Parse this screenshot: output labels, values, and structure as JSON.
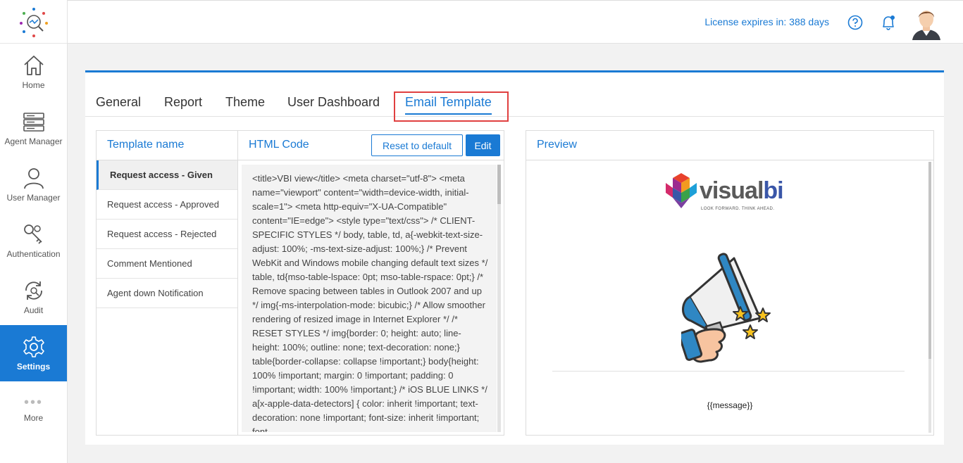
{
  "sidebar": {
    "items": [
      {
        "label": "Home",
        "icon": "home-icon"
      },
      {
        "label": "Agent Manager",
        "icon": "agent-manager-icon"
      },
      {
        "label": "User Manager",
        "icon": "user-icon"
      },
      {
        "label": "Authentication",
        "icon": "keys-icon"
      },
      {
        "label": "Audit",
        "icon": "audit-icon"
      },
      {
        "label": "Settings",
        "icon": "gear-icon",
        "active": true
      },
      {
        "label": "More",
        "icon": "more-icon"
      }
    ]
  },
  "header": {
    "license_text": "License expires in: 388 days"
  },
  "tabs": [
    {
      "label": "General"
    },
    {
      "label": "Report"
    },
    {
      "label": "Theme"
    },
    {
      "label": "User Dashboard"
    },
    {
      "label": "Email Template",
      "active": true
    }
  ],
  "templates": {
    "title": "Template name",
    "items": [
      "Request access - Given",
      "Request access - Approved",
      "Request access - Rejected",
      "Comment Mentioned",
      "Agent down Notification"
    ],
    "selected": "Request access - Given"
  },
  "code": {
    "title": "HTML Code",
    "reset_label": "Reset to default",
    "edit_label": "Edit",
    "content": "<title>VBI view</title> <meta charset=\"utf-8\"> <meta name=\"viewport\" content=\"width=device-width, initial-scale=1\"> <meta http-equiv=\"X-UA-Compatible\" content=\"IE=edge\"> <style type=\"text/css\"> /* CLIENT-SPECIFIC STYLES */ body, table, td, a{-webkit-text-size-adjust: 100%; -ms-text-size-adjust: 100%;} /* Prevent WebKit and Windows mobile changing default text sizes */ table, td{mso-table-lspace: 0pt; mso-table-rspace: 0pt;} /* Remove spacing between tables in Outlook 2007 and up */ img{-ms-interpolation-mode: bicubic;} /* Allow smoother rendering of resized image in Internet Explorer */ /* RESET STYLES */ img{border: 0; height: auto; line-height: 100%; outline: none; text-decoration: none;} table{border-collapse: collapse !important;} body{height: 100% !important; margin: 0 !important; padding: 0 !important; width: 100% !important;} /* iOS BLUE LINKS */ a[x-apple-data-detectors] { color: inherit !important; text-decoration: none !important; font-size: inherit !important; font-"
  },
  "preview": {
    "title": "Preview",
    "brand_left": "visual",
    "brand_right": "bi",
    "tagline": "LOOK FORWARD. THINK AHEAD.",
    "message": "{{message}}"
  },
  "colors": {
    "accent": "#1a7ad4",
    "highlight": "#e04040"
  }
}
